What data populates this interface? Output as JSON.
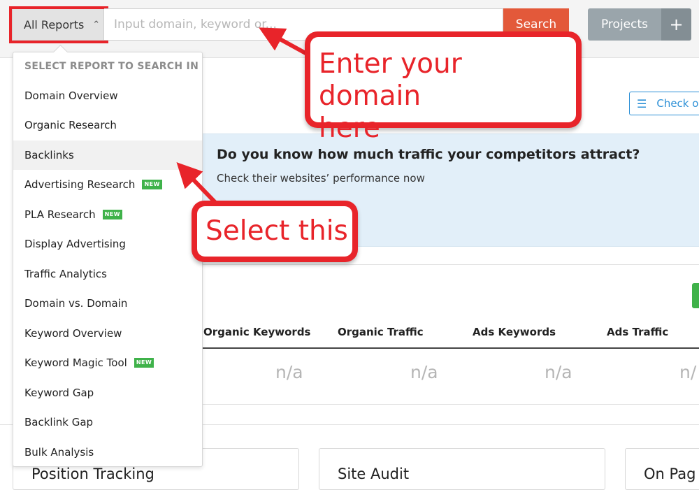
{
  "topbar": {
    "report_select_label": "All Reports",
    "search_placeholder": "Input domain, keyword or...",
    "search_button": "Search",
    "projects_button": "Projects",
    "add_button": "+"
  },
  "check_button": "Check o",
  "banner": {
    "title": "Do you know how much traffic your competitors attract?",
    "subtitle": "Check their websites’ performance now"
  },
  "dropdown": {
    "header": "SELECT REPORT TO SEARCH IN",
    "items": [
      {
        "label": "Domain Overview",
        "badge": ""
      },
      {
        "label": "Organic Research",
        "badge": ""
      },
      {
        "label": "Backlinks",
        "badge": ""
      },
      {
        "label": "Advertising Research",
        "badge": "NEW"
      },
      {
        "label": "PLA Research",
        "badge": "NEW"
      },
      {
        "label": "Display Advertising",
        "badge": ""
      },
      {
        "label": "Traffic Analytics",
        "badge": ""
      },
      {
        "label": "Domain vs. Domain",
        "badge": ""
      },
      {
        "label": "Keyword Overview",
        "badge": ""
      },
      {
        "label": "Keyword Magic Tool",
        "badge": "NEW"
      },
      {
        "label": "Keyword Gap",
        "badge": ""
      },
      {
        "label": "Backlink Gap",
        "badge": ""
      },
      {
        "label": "Bulk Analysis",
        "badge": ""
      }
    ]
  },
  "table": {
    "columns": [
      "Organic Keywords",
      "Organic Traffic",
      "Ads Keywords",
      "Ads Traffic"
    ],
    "values": [
      "n/a",
      "n/a",
      "n/a",
      "n/"
    ]
  },
  "cards": [
    "Position Tracking",
    "Site Audit",
    "On Pag"
  ],
  "annotations": {
    "callout_domain_line1": "Enter your domain",
    "callout_domain_line2": "here",
    "callout_select": "Select this"
  },
  "colors": {
    "annotation_red": "#e8242a",
    "search_orange": "#e3593a",
    "new_badge_green": "#3fb24a",
    "link_blue": "#2b8fd6"
  }
}
